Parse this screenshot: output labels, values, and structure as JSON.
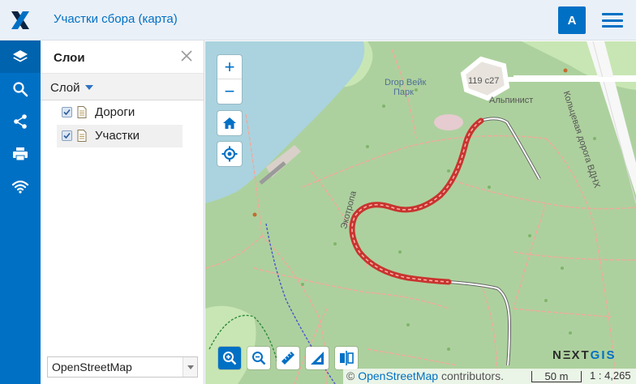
{
  "header": {
    "title": "Участки сбора (карта)",
    "avatar_letter": "A"
  },
  "iconbar": {
    "items": [
      "layers-icon",
      "search-icon",
      "share-icon",
      "print-icon",
      "wifi-icon"
    ]
  },
  "panel": {
    "title": "Слои",
    "layer_header": "Слой",
    "layers": [
      {
        "label": "Дороги",
        "checked": true
      },
      {
        "label": "Участки",
        "checked": true
      }
    ],
    "basemap_selected": "OpenStreetMap"
  },
  "map": {
    "zoom_in": "+",
    "zoom_out": "−",
    "labels": {
      "park": "Drop Вейк",
      "park2": "Парк",
      "building": "119 с27",
      "alpinist": "Альпинист",
      "ring_road": "Кольцевая дорога ВДНХ",
      "ecotrail": "Экотропа"
    },
    "brand_prefix": "N",
    "brand_mid": "XT",
    "brand_gis": "GIS",
    "attribution_prefix": "©",
    "attribution_link": "OpenStreetMap",
    "attribution_suffix": "contributors.",
    "scale_bar": "50 m",
    "scale_ratio": "1 : 4,265",
    "colors": {
      "accent": "#0070c5",
      "water": "#aad3df",
      "forest": "#add19e",
      "route": "#c8342f"
    }
  }
}
